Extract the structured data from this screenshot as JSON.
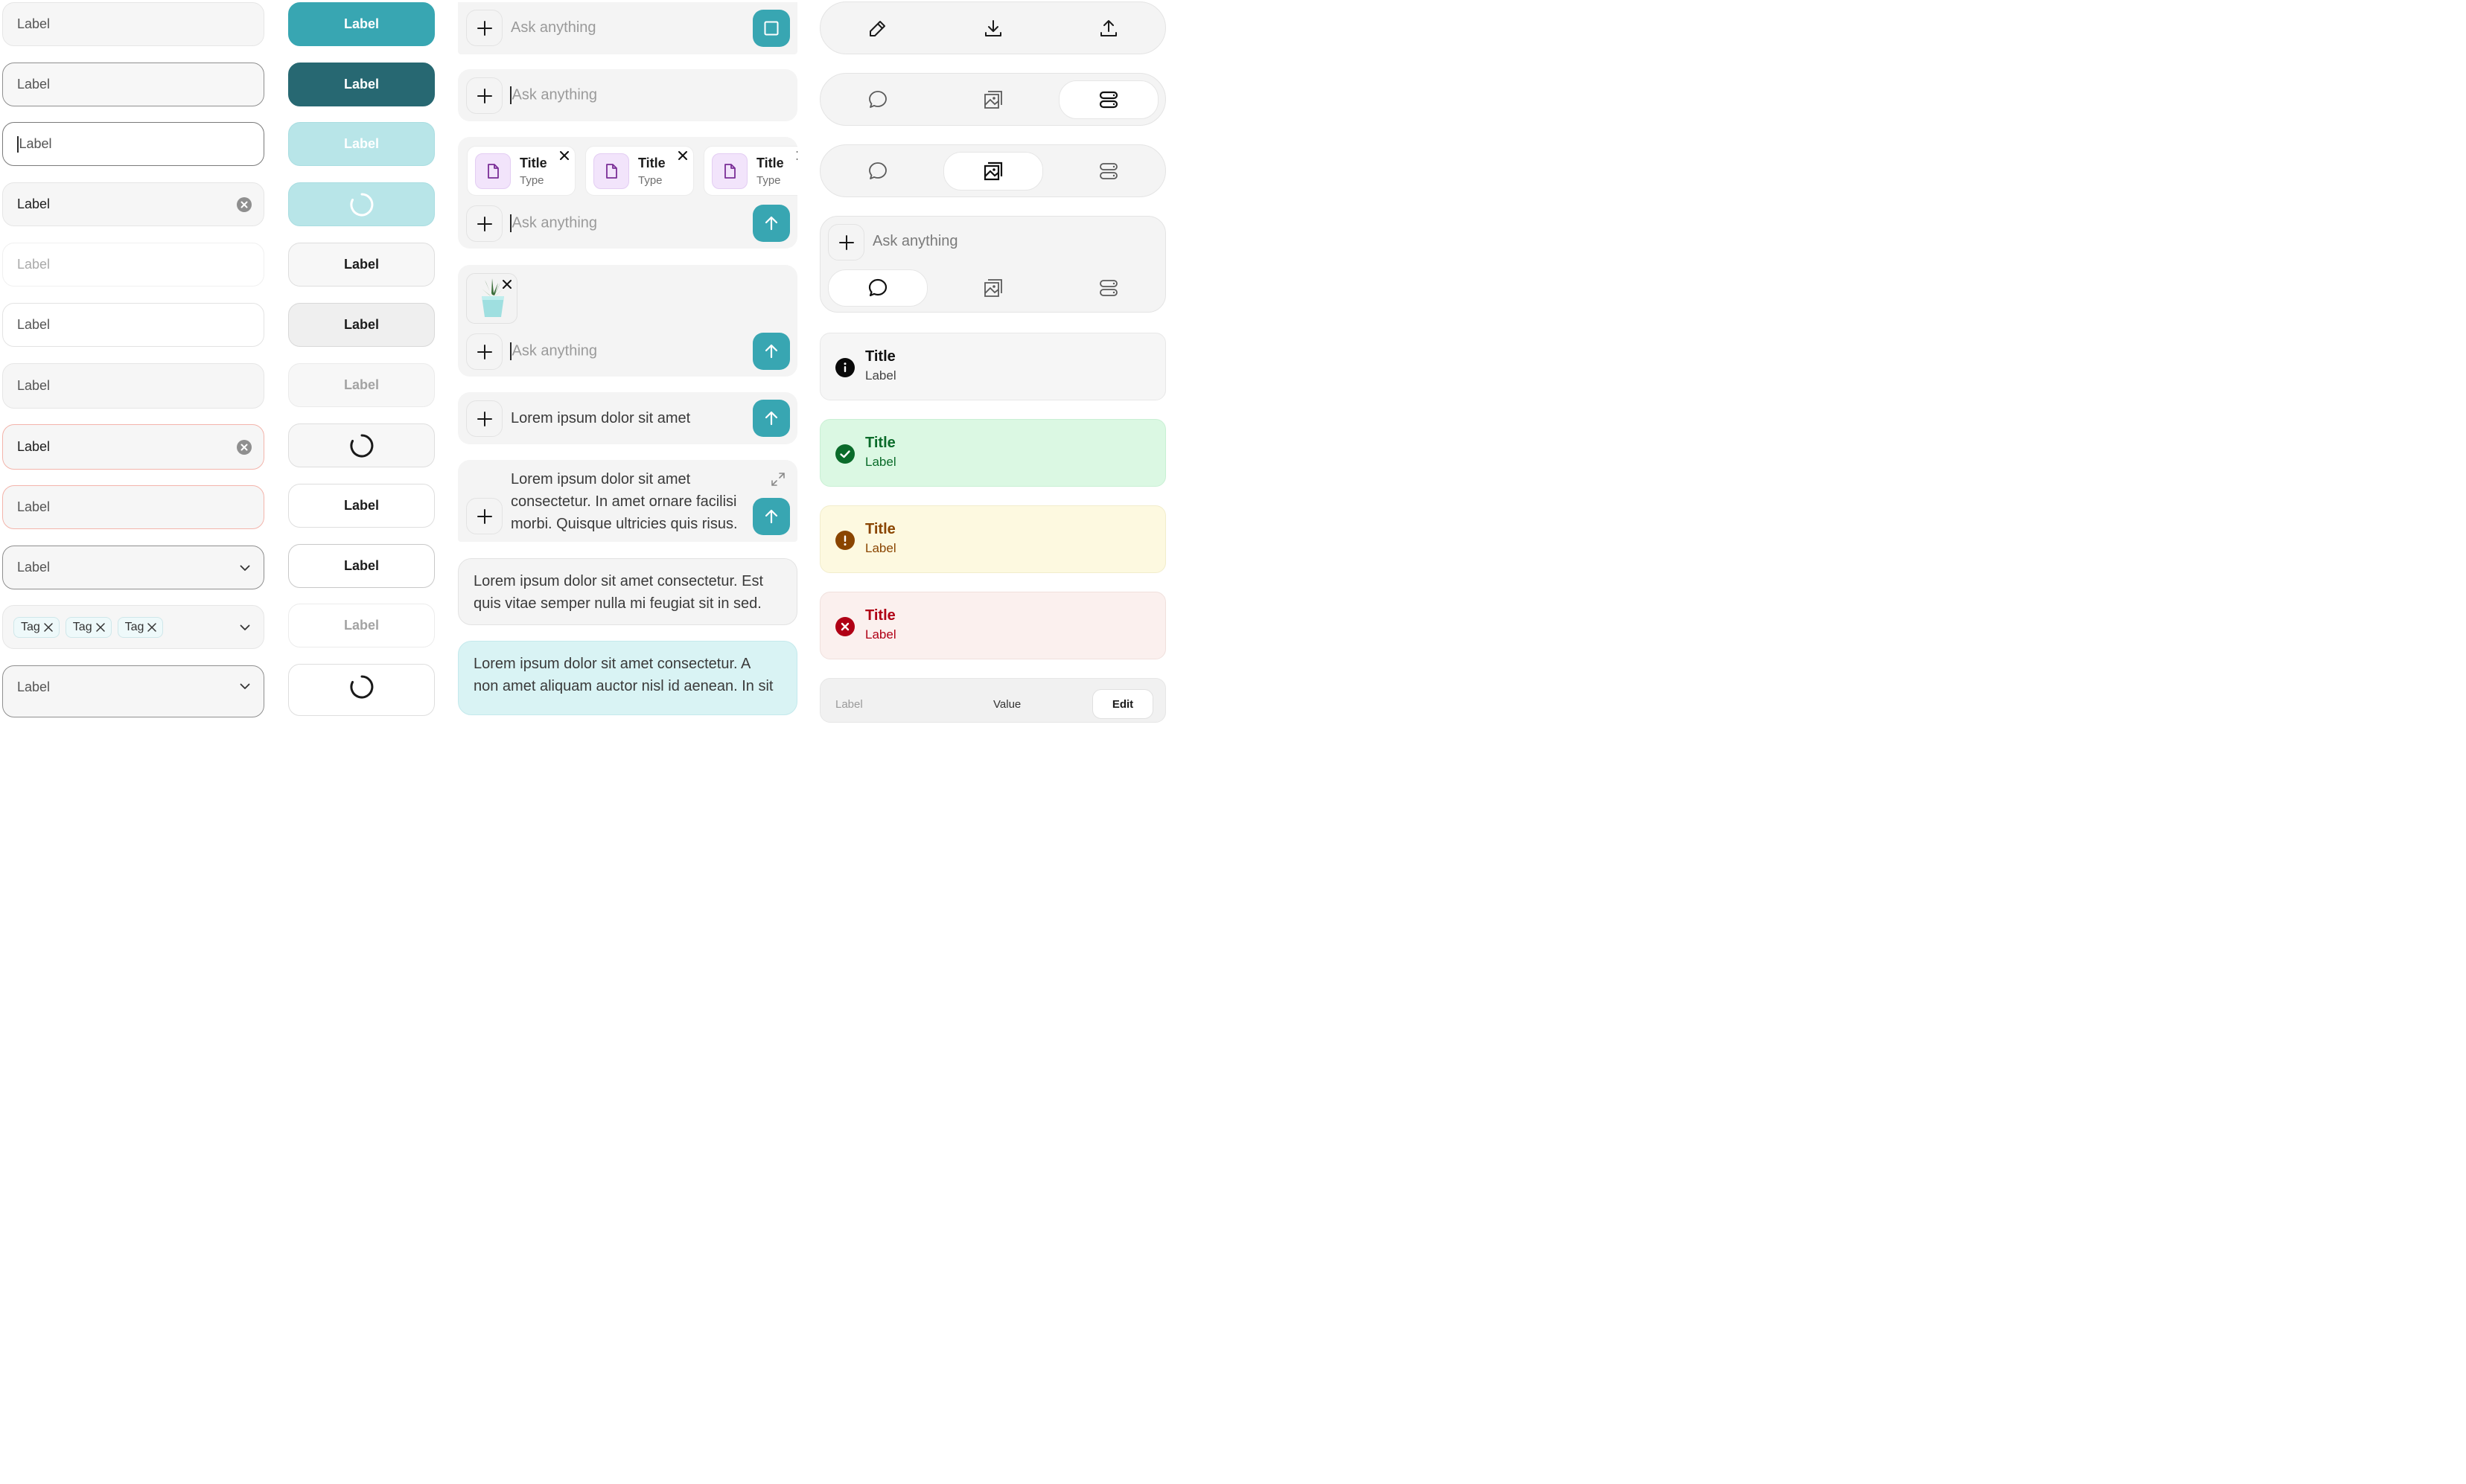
{
  "inputs": {
    "label": "Label",
    "items": [
      {
        "value": "Label"
      },
      {
        "value": "Label"
      },
      {
        "value": "Label"
      },
      {
        "value": "Label"
      },
      {
        "value": "Label"
      },
      {
        "value": "Label"
      },
      {
        "value": "Label"
      },
      {
        "value": "Label"
      },
      {
        "value": "Label"
      },
      {
        "value": "Label"
      },
      {
        "value": "Label"
      }
    ],
    "tags": [
      "Tag",
      "Tag",
      "Tag"
    ]
  },
  "buttons": {
    "label": "Label",
    "items": [
      "Label",
      "Label",
      "Label",
      "Label",
      "Label",
      "Label",
      "Label",
      "Label",
      "Label",
      "Label",
      "Label",
      "Label"
    ]
  },
  "composer": {
    "placeholder": "Ask anything",
    "files": [
      {
        "title": "Title",
        "type": "Type"
      },
      {
        "title": "Title",
        "type": "Type"
      },
      {
        "title": "Title",
        "type": "Type"
      }
    ],
    "single_line_value": "Lorem ipsum dolor sit amet",
    "multi_line_value": [
      "Lorem ipsum dolor sit amet",
      "consectetur. In amet ornare facilisi",
      "morbi. Quisque ultricies quis risus."
    ],
    "message_received": [
      "Lorem ipsum dolor sit amet consectetur. Est",
      "quis vitae semper nulla mi feugiat sit in sed."
    ],
    "message_sent": [
      "Lorem ipsum dolor sit amet consectetur. A",
      "non amet aliquam auctor nisl id aenean. In sit"
    ]
  },
  "toolbar": {
    "icons": [
      "edit-icon",
      "download-icon",
      "upload-icon"
    ],
    "mode_icons": [
      "chat-icon",
      "image-icon",
      "layout-icon"
    ],
    "placeholder": "Ask anything"
  },
  "alerts": [
    {
      "kind": "info",
      "title": "Title",
      "label": "Label",
      "bg": "#f6f6f6",
      "color": "#1a1a1a",
      "icon_bg": "#0a0a0a"
    },
    {
      "kind": "success",
      "title": "Title",
      "label": "Label",
      "bg": "#dbf8e3",
      "color": "#0a6b2a",
      "icon_bg": "#0a6b2a"
    },
    {
      "kind": "warning",
      "title": "Title",
      "label": "Label",
      "bg": "#fdf9e0",
      "color": "#8a4500",
      "icon_bg": "#8a4500"
    },
    {
      "kind": "error",
      "title": "Title",
      "label": "Label",
      "bg": "#fbf0ee",
      "color": "#b00015",
      "icon_bg": "#b00015"
    }
  ],
  "table_row": {
    "label": "Label",
    "value": "Value",
    "edit": "Edit"
  },
  "colors": {
    "accent": "#38a6b2",
    "accent_dark": "#276872",
    "accent_light": "#b8e5e8"
  }
}
